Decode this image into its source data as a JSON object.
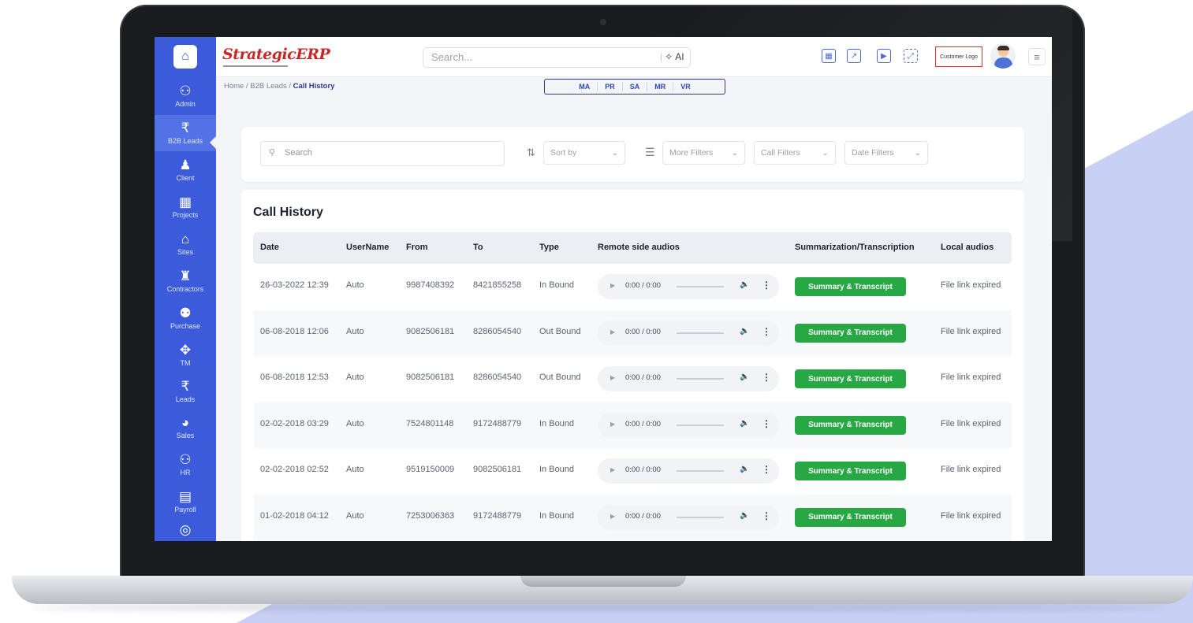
{
  "colors": {
    "sidebar": "#3b5bdb",
    "accent": "#2d46b9",
    "button_green": "#27a844",
    "logo_red": "#c62828",
    "backdrop": "#c9d0f5"
  },
  "sidebar": {
    "home_icon": "home-icon",
    "items": [
      {
        "label": "Admin",
        "icon": "admin-icon",
        "glyph": "⚇"
      },
      {
        "label": "B2B Leads",
        "icon": "rupee-circle-icon",
        "glyph": "₹"
      },
      {
        "label": "Client",
        "icon": "person-icon",
        "glyph": "♟"
      },
      {
        "label": "Projects",
        "icon": "projects-icon",
        "glyph": "▦"
      },
      {
        "label": "Sites",
        "icon": "sites-icon",
        "glyph": "⌂"
      },
      {
        "label": "Contractors",
        "icon": "contractor-icon",
        "glyph": "♜"
      },
      {
        "label": "Purchase",
        "icon": "purchase-icon",
        "glyph": "⚉"
      },
      {
        "label": "TM",
        "icon": "tm-icon",
        "glyph": "✥"
      },
      {
        "label": "Leads",
        "icon": "leads-icon",
        "glyph": "₹"
      },
      {
        "label": "Sales",
        "icon": "pie-icon",
        "glyph": "◕"
      },
      {
        "label": "HR",
        "icon": "hr-icon",
        "glyph": "⚇"
      },
      {
        "label": "Payroll",
        "icon": "payroll-icon",
        "glyph": "▤"
      }
    ]
  },
  "header": {
    "logo_text": "StrategicERP",
    "search_placeholder": "Search...",
    "ai_label": "AI",
    "customer_logo": "Customer Logo"
  },
  "breadcrumb": {
    "home": "Home",
    "sep": "/",
    "parent": "B2B Leads",
    "current": "Call History"
  },
  "module_tabs": [
    "MA",
    "PR",
    "SA",
    "MR",
    "VR"
  ],
  "filters": {
    "search_placeholder": "Search",
    "sort_by": "Sort by",
    "more_filters": "More Filters",
    "call_filters": "Call Filters",
    "date_filters": "Date Filters"
  },
  "table": {
    "title": "Call History",
    "columns": [
      "Date",
      "UserName",
      "From",
      "To",
      "Type",
      "Remote side audios",
      "Summarization/Transcription",
      "Local audios"
    ],
    "audio_time": "0:00 / 0:00",
    "summary_label": "Summary & Transcript",
    "rows": [
      {
        "date": "26-03-2022 12:39",
        "user": "Auto",
        "from": "9987408392",
        "to": "8421855258",
        "type": "In Bound",
        "local": "File link expired"
      },
      {
        "date": "06-08-2018 12:06",
        "user": "Auto",
        "from": "9082506181",
        "to": "8286054540",
        "type": "Out Bound",
        "local": "File link expired"
      },
      {
        "date": "06-08-2018 12:53",
        "user": "Auto",
        "from": "9082506181",
        "to": "8286054540",
        "type": "Out Bound",
        "local": "File link expired"
      },
      {
        "date": "02-02-2018 03:29",
        "user": "Auto",
        "from": "7524801148",
        "to": "9172488779",
        "type": "In Bound",
        "local": "File link expired"
      },
      {
        "date": "02-02-2018 02:52",
        "user": "Auto",
        "from": "9519150009",
        "to": "9082506181",
        "type": "In Bound",
        "local": "File link expired"
      },
      {
        "date": "01-02-2018 04:12",
        "user": "Auto",
        "from": "7253006363",
        "to": "9172488779",
        "type": "In Bound",
        "local": "File link expired"
      }
    ]
  }
}
